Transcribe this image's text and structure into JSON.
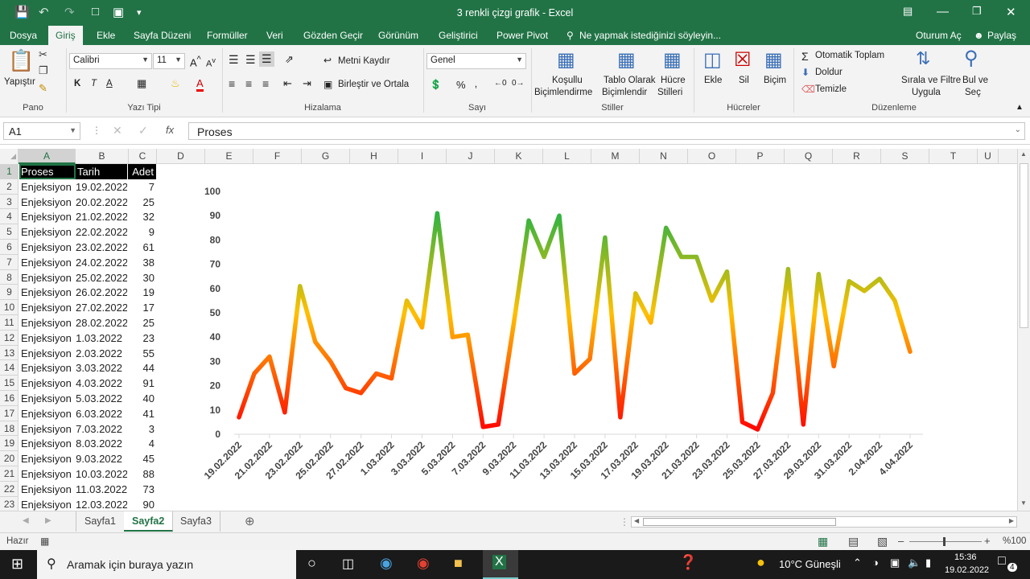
{
  "title": {
    "doc": "3 renkli çizgi grafik - Excel"
  },
  "tabs": [
    "Dosya",
    "Giriş",
    "Ekle",
    "Sayfa Düzeni",
    "Formüller",
    "Veri",
    "Gözden Geçir",
    "Görünüm",
    "Geliştirici",
    "Power Pivot"
  ],
  "tell_me": "Ne yapmak istediğinizi söyleyin...",
  "signin": "Oturum Aç",
  "share": "Paylaş",
  "ribbon": {
    "paste": "Yapıştır",
    "font_name": "Calibri",
    "font_size": "11",
    "wrap": "Metni Kaydır",
    "merge": "Birleştir ve Ortala",
    "number_format": "Genel",
    "cond1": "Koşullu",
    "cond2": "Biçimlendirme",
    "table1": "Tablo Olarak",
    "table2": "Biçimlendir",
    "cell1": "Hücre",
    "cell2": "Stilleri",
    "insert": "Ekle",
    "delete": "Sil",
    "format": "Biçim",
    "autosum": "Otomatik Toplam",
    "fill": "Doldur",
    "clear": "Temizle",
    "sort1": "Sırala ve Filtre",
    "sort2": "Uygula",
    "find1": "Bul ve",
    "find2": "Seç",
    "groups": [
      "Pano",
      "Yazı Tipi",
      "Hizalama",
      "Sayı",
      "Stiller",
      "Hücreler",
      "Düzenleme"
    ]
  },
  "formula": {
    "namebox": "A1",
    "fx": "fx",
    "value": "Proses"
  },
  "columns": [
    "A",
    "B",
    "C",
    "D",
    "E",
    "F",
    "G",
    "H",
    "I",
    "J",
    "K",
    "L",
    "M",
    "N",
    "O",
    "P",
    "Q",
    "R",
    "S",
    "T",
    "U"
  ],
  "table": {
    "headers": [
      "Proses",
      "Tarih",
      "Adet"
    ],
    "rows": [
      [
        "Enjeksiyon",
        "19.02.2022",
        "7"
      ],
      [
        "Enjeksiyon",
        "20.02.2022",
        "25"
      ],
      [
        "Enjeksiyon",
        "21.02.2022",
        "32"
      ],
      [
        "Enjeksiyon",
        "22.02.2022",
        "9"
      ],
      [
        "Enjeksiyon",
        "23.02.2022",
        "61"
      ],
      [
        "Enjeksiyon",
        "24.02.2022",
        "38"
      ],
      [
        "Enjeksiyon",
        "25.02.2022",
        "30"
      ],
      [
        "Enjeksiyon",
        "26.02.2022",
        "19"
      ],
      [
        "Enjeksiyon",
        "27.02.2022",
        "17"
      ],
      [
        "Enjeksiyon",
        "28.02.2022",
        "25"
      ],
      [
        "Enjeksiyon",
        "1.03.2022",
        "23"
      ],
      [
        "Enjeksiyon",
        "2.03.2022",
        "55"
      ],
      [
        "Enjeksiyon",
        "3.03.2022",
        "44"
      ],
      [
        "Enjeksiyon",
        "4.03.2022",
        "91"
      ],
      [
        "Enjeksiyon",
        "5.03.2022",
        "40"
      ],
      [
        "Enjeksiyon",
        "6.03.2022",
        "41"
      ],
      [
        "Enjeksiyon",
        "7.03.2022",
        "3"
      ],
      [
        "Enjeksiyon",
        "8.03.2022",
        "4"
      ],
      [
        "Enjeksiyon",
        "9.03.2022",
        "45"
      ],
      [
        "Enjeksiyon",
        "10.03.2022",
        "88"
      ],
      [
        "Enjeksiyon",
        "11.03.2022",
        "73"
      ],
      [
        "Enjeksiyon",
        "12.03.2022",
        "90"
      ]
    ]
  },
  "chart_data": {
    "type": "line",
    "ylim": [
      0,
      100
    ],
    "yticks": [
      "0",
      "10",
      "20",
      "30",
      "40",
      "50",
      "60",
      "70",
      "80",
      "90",
      "100"
    ],
    "xticks": [
      "19.02.2022",
      "21.02.2022",
      "23.02.2022",
      "25.02.2022",
      "27.02.2022",
      "1.03.2022",
      "3.03.2022",
      "5.03.2022",
      "7.03.2022",
      "9.03.2022",
      "11.03.2022",
      "13.03.2022",
      "15.03.2022",
      "17.03.2022",
      "19.03.2022",
      "21.03.2022",
      "23.03.2022",
      "25.03.2022",
      "27.03.2022",
      "29.03.2022",
      "31.03.2022",
      "2.04.2022",
      "4.04.2022"
    ],
    "values": [
      7,
      25,
      32,
      9,
      61,
      38,
      30,
      19,
      17,
      25,
      23,
      55,
      44,
      91,
      40,
      41,
      3,
      4,
      45,
      88,
      73,
      90,
      25,
      31,
      81,
      7,
      58,
      46,
      85,
      73,
      73,
      55,
      67,
      5,
      2,
      17,
      68,
      4,
      66,
      28,
      63,
      59,
      64,
      55,
      34
    ],
    "gradient": [
      "#ff0000",
      "#ffc000",
      "#00b050"
    ]
  },
  "sheets": [
    "Sayfa1",
    "Sayfa2",
    "Sayfa3"
  ],
  "status": {
    "ready": "Hazır",
    "zoom": "%100"
  },
  "taskbar": {
    "search": "Aramak için buraya yazın",
    "weather": "10°C  Güneşli",
    "time": "15:36",
    "date": "19.02.2022",
    "notif": "4"
  }
}
